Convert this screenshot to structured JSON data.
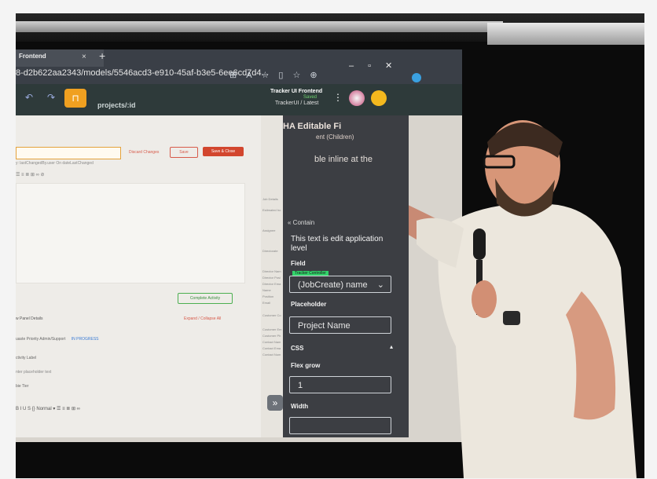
{
  "browser": {
    "tab_title": "Frontend",
    "tab_close": "×",
    "new_tab": "+",
    "url": "8-d2b622aa2343/models/5546acd3-e910-45af-b3e5-6ee6cd7d4..."
  },
  "app": {
    "route": "projects/:id",
    "name": "Tracker UI Frontend",
    "status": "Saved",
    "version": "TrackerUI / Latest"
  },
  "form": {
    "discard_label": "Discard Changes",
    "save_label": "Save",
    "save_close_label": "Save & Close",
    "subtext": "y: lastChangedBy.user On dateLastChanged",
    "complete_label": "Complete Activity",
    "view_panel_label": "w Panel Details",
    "expand_collapse_label": "Expand / Collapse All",
    "row_priority": "uaste Priority Admin/Support",
    "row_priority_status": "IN PROGRESS",
    "row_activity": "ctivity Label",
    "row_placeholder": "nter placeholder text",
    "row_tier": "bie Tier",
    "format_label": "Normal"
  },
  "sidebar": {
    "job_details": "Job Details",
    "estimated": "Estimated ho",
    "assignee": "Assignee",
    "directorate": "Directorate",
    "director_name": "Director Nam",
    "director_pos": "Director Posi",
    "director_email": "Director Ema",
    "name": "Name",
    "position": "Position",
    "email": "Email",
    "customer_co": "Customer Co",
    "customer_em": "Customer Em",
    "customer_ph": "Customer Ph",
    "contact_nam": "Contact Nam",
    "contact_ema": "Contact Ema",
    "contact_num": "Contact Num"
  },
  "panel": {
    "overlay_heading": "HA Editable Fi",
    "overlay_sub": "ent (Children)",
    "overlay_inline": "ble inline at the",
    "container_label": "« Contain",
    "editable_text": "This text is edit application level",
    "field_label": "Field",
    "tracker_badge": "Tracker Controller",
    "field_value": "(JobCreate) name",
    "placeholder_label": "Placeholder",
    "placeholder_value": "Project Name",
    "css_label": "CSS",
    "flex_grow_label": "Flex grow",
    "flex_grow_value": "1",
    "width_label": "Width",
    "width_value": ""
  },
  "colors": {
    "lock_button": "#f0a020",
    "save_close": "#d2462e",
    "complete_green": "#4caf50",
    "saved_green": "#6fd26f",
    "panel_bg": "#3c3e43"
  }
}
